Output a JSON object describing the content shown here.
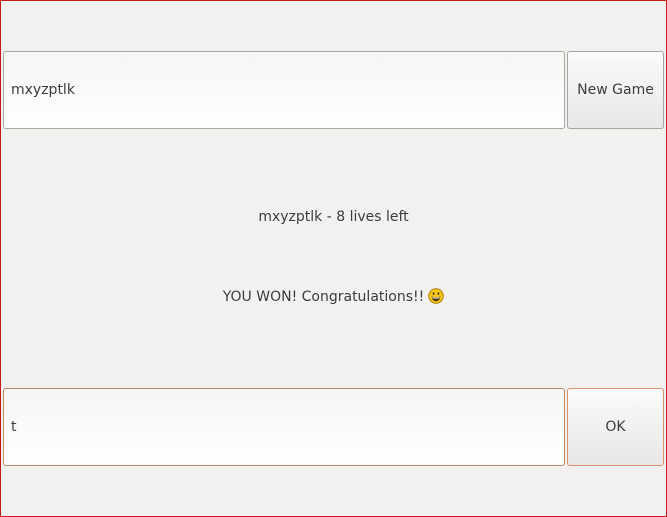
{
  "word_entry": {
    "value": "mxyzptlk"
  },
  "new_game_button": {
    "label": "New Game"
  },
  "status": {
    "lives_text": "mxyzptlk - 8 lives left",
    "result_text": "YOU WON! Congratulations!!"
  },
  "result_icon": "grinning-face-emoji",
  "guess_entry": {
    "value": "t"
  },
  "ok_button": {
    "label": "OK"
  },
  "colors": {
    "window_background": "#f2f1f0",
    "window_border": "#c41a1a",
    "focus_accent": "#d9926d",
    "text": "#3c3c3c"
  }
}
